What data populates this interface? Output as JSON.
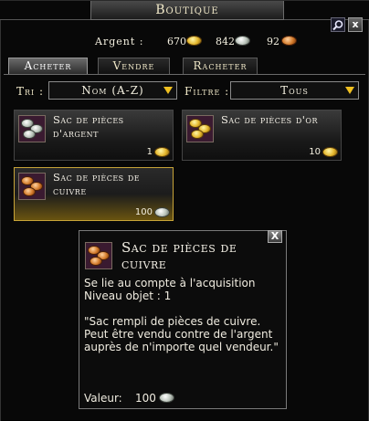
{
  "window": {
    "title": "Boutique"
  },
  "money": {
    "label": "Argent :",
    "gold": "670",
    "silver": "842",
    "copper": "92"
  },
  "tabs": [
    {
      "label": "Acheter",
      "active": true
    },
    {
      "label": "Vendre",
      "active": false
    },
    {
      "label": "Racheter",
      "active": false
    }
  ],
  "filters": {
    "sort_label": "Tri :",
    "sort_value": "Nom (A-Z)",
    "filter_label": "Filtre :",
    "filter_value": "Tous"
  },
  "items": [
    {
      "name": "Sac de pièces d'argent",
      "price": "1",
      "currency": "gold",
      "icon": "silver-coin-bag-icon"
    },
    {
      "name": "Sac de pièces d'or",
      "price": "10",
      "currency": "gold",
      "icon": "gold-coin-bag-icon"
    },
    {
      "name": "Sac de pièces de cuivre",
      "price": "100",
      "currency": "silver",
      "icon": "copper-coin-bag-icon",
      "selected": true
    }
  ],
  "tooltip": {
    "title": "Sac de pièces de cuivre",
    "binding": "Se lie au compte à l'acquisition",
    "level": "Niveau objet : 1",
    "description": "\"Sac rempli de pièces de cuivre. Peut être vendu contre de l'argent auprès de n'importe quel vendeur.\"",
    "value_label": "Valeur:",
    "value_amount": "100",
    "close": "X"
  },
  "colors": {
    "accent_gold": "#c8a438",
    "dropdown_arrow": "#f0c020"
  }
}
